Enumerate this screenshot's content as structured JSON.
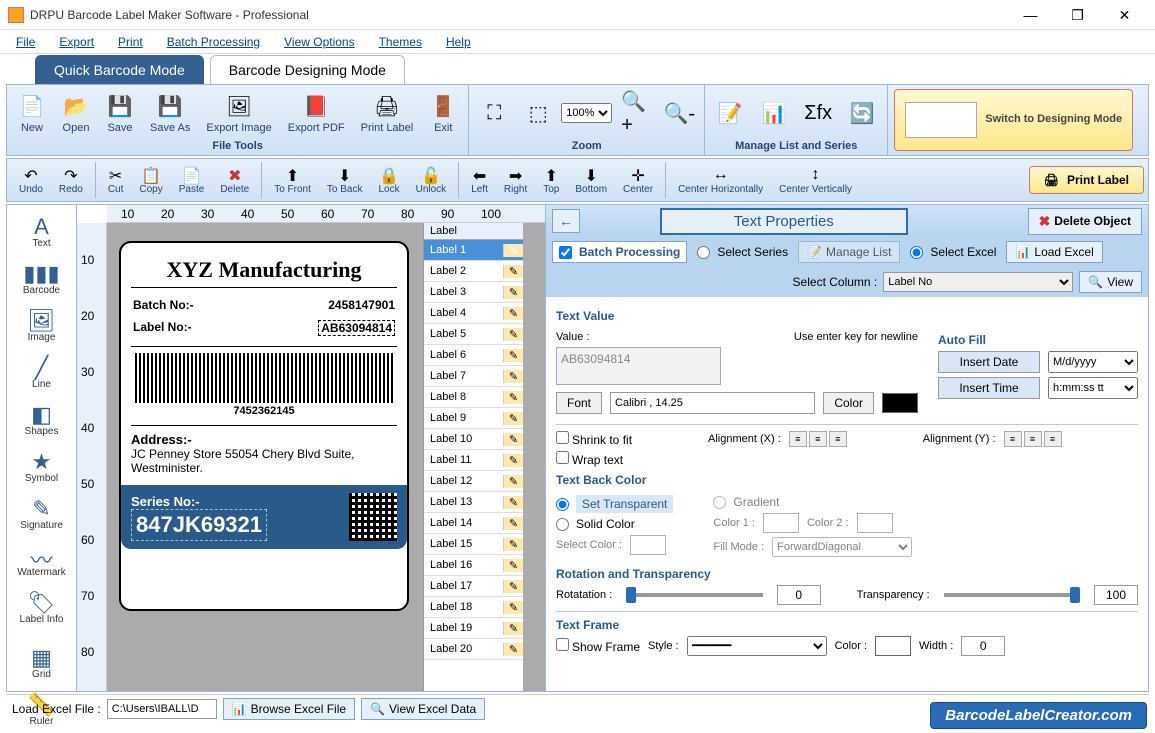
{
  "title": "DRPU Barcode Label Maker Software - Professional",
  "menu": [
    "File",
    "Export",
    "Print",
    "Batch Processing",
    "View Options",
    "Themes",
    "Help"
  ],
  "modes": {
    "quick": "Quick Barcode Mode",
    "design": "Barcode Designing Mode"
  },
  "ribbon": {
    "file": {
      "label": "File Tools",
      "items": [
        "New",
        "Open",
        "Save",
        "Save As",
        "Export Image",
        "Export PDF",
        "Print Label",
        "Exit"
      ]
    },
    "zoom": {
      "label": "Zoom",
      "value": "100%"
    },
    "manage": {
      "label": "Manage List and Series"
    },
    "switch": "Switch to Designing Mode"
  },
  "toolbar2": [
    "Undo",
    "Redo",
    "Cut",
    "Copy",
    "Paste",
    "Delete",
    "To Front",
    "To Back",
    "Lock",
    "Unlock",
    "Left",
    "Right",
    "Top",
    "Bottom",
    "Center",
    "Center Horizontally",
    "Center Vertically"
  ],
  "printlabel": "Print Label",
  "lefttools": [
    "Text",
    "Barcode",
    "Image",
    "Line",
    "Shapes",
    "Symbol",
    "Signature",
    "Watermark",
    "Label Info",
    "Grid",
    "Ruler"
  ],
  "label": {
    "company": "XYZ Manufacturing",
    "batchno_l": "Batch No:-",
    "batchno_v": "2458147901",
    "labelno_l": "Label No:-",
    "labelno_v": "AB63094814",
    "barcode": "7452362145",
    "addr_l": "Address:-",
    "addr_v": "JC Penney Store 55054 Chery Blvd Suite, Westminister.",
    "series_l": "Series No:-",
    "series_v": "847JK69321"
  },
  "labellist": {
    "header": "Label",
    "items": [
      "Label 1",
      "Label 2",
      "Label 3",
      "Label 4",
      "Label 5",
      "Label 6",
      "Label 7",
      "Label 8",
      "Label 9",
      "Label 10",
      "Label 11",
      "Label 12",
      "Label 13",
      "Label 14",
      "Label 15",
      "Label 16",
      "Label 17",
      "Label 18",
      "Label 19",
      "Label 20"
    ]
  },
  "right": {
    "title": "Text Properties",
    "delete": "Delete Object",
    "batch": "Batch Processing",
    "selseries": "Select Series",
    "managelist": "Manage List",
    "selexcel": "Select Excel",
    "loadexcel": "Load Excel",
    "selectcolumn": "Select Column :",
    "columnval": "Label No",
    "view": "View",
    "textvalue": "Text Value",
    "value_l": "Value :",
    "value_hint": "Use enter key for newline",
    "value_v": "AB63094814",
    "font": "Font",
    "fontval": "Calibri , 14.25",
    "color": "Color",
    "autofill": "Auto Fill",
    "insdate": "Insert Date",
    "datefmt": "M/d/yyyy",
    "instime": "Insert Time",
    "timefmt": "h:mm:ss tt",
    "shrink": "Shrink to fit",
    "wrap": "Wrap text",
    "alignx": "Alignment (X) :",
    "aligny": "Alignment (Y) :",
    "backcolor": "Text Back Color",
    "transp": "Set Transparent",
    "solid": "Solid Color",
    "selcolor": "Select Color :",
    "gradient": "Gradient",
    "c1": "Color 1 :",
    "c2": "Color 2 :",
    "fillmode": "Fill Mode :",
    "fillval": "ForwardDiagonal",
    "rottr": "Rotation and Transparency",
    "rot": "Rotatation :",
    "rotval": "0",
    "trans": "Transparency :",
    "transval": "100",
    "frame": "Text Frame",
    "show": "Show Frame",
    "style": "Style :",
    "fcolor": "Color :",
    "width": "Width :",
    "widthval": "0"
  },
  "bottom": {
    "load": "Load Excel File :",
    "path": "C:\\Users\\IBALL\\D",
    "browse": "Browse Excel File",
    "view": "View Excel Data"
  },
  "brand": "BarcodeLabelCreator.com",
  "ruler_h": [
    10,
    20,
    30,
    40,
    50,
    60,
    70,
    80,
    90,
    100
  ],
  "ruler_v": [
    10,
    20,
    30,
    40,
    50,
    60,
    70,
    80
  ]
}
